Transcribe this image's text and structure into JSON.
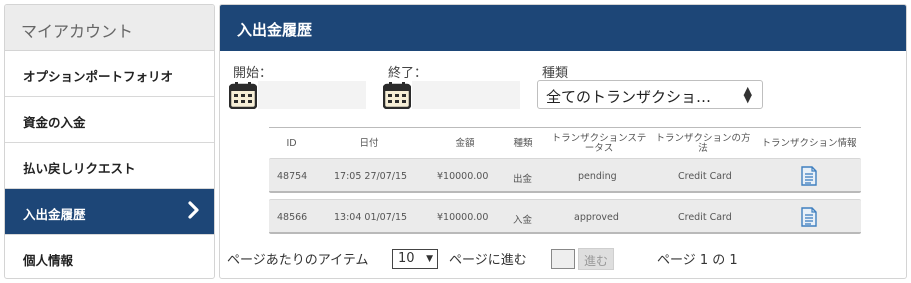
{
  "sidebar": {
    "title": "マイアカウント",
    "items": [
      {
        "label": "オプションポートフォリオ"
      },
      {
        "label": "資金の入金"
      },
      {
        "label": "払い戻しリクエスト"
      },
      {
        "label": "入出金履歴"
      },
      {
        "label": "個人情報"
      }
    ],
    "active_index": 3
  },
  "main": {
    "title": "入出金履歴",
    "filters": {
      "start_label": "開始：",
      "end_label": "終了：",
      "type_label": "種類",
      "type_selected": "全てのトランザクショ…"
    },
    "table": {
      "headers": {
        "id": "ID",
        "date": "日付",
        "amount": "金額",
        "kind": "種類",
        "status_1": "トランザクションステ",
        "status_2": "ータス",
        "method_1": "トランザクションの方",
        "method_2": "法",
        "info": "トランザクション情報"
      },
      "rows": [
        {
          "id": "48754",
          "date": "17:05 27/07/15",
          "amount": "¥10000.00",
          "kind": "出金",
          "status": "pending",
          "method": "Credit Card",
          "info_icon": "document-icon"
        },
        {
          "id": "48566",
          "date": "13:04 01/07/15",
          "amount": "¥10000.00",
          "kind": "入金",
          "status": "approved",
          "method": "Credit Card",
          "info_icon": "document-icon"
        }
      ]
    },
    "pagination": {
      "per_page_label": "ページあたりのアイテム",
      "per_page_value": "10",
      "goto_label": "ページに進む",
      "goto_button": "進む",
      "page_info": "ページ 1 の 1"
    }
  },
  "colors": {
    "accent": "#1d4677",
    "icon_blue": "#3f7fbf"
  }
}
